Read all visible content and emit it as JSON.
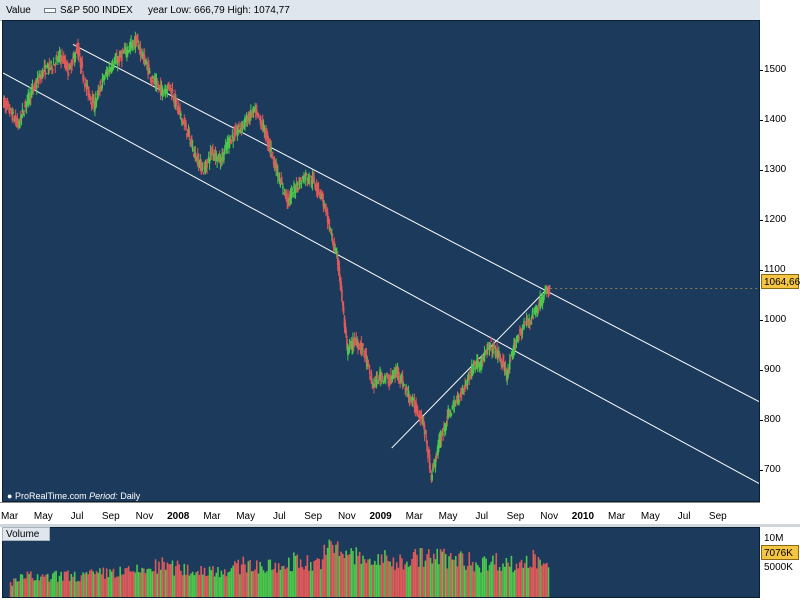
{
  "header": {
    "value_label": "Value",
    "index_name": "S&P 500 INDEX",
    "range_text": "year Low: 666,79  High: 1074,77"
  },
  "credit": {
    "source": "ProRealTime.com",
    "period_label": "Period:",
    "period_value": "Daily"
  },
  "volume_panel": {
    "title": "Volume",
    "last_value_label": "7076K",
    "ticks": [
      {
        "value": 10,
        "label": "10M"
      },
      {
        "value": 5,
        "label": "5000K"
      }
    ],
    "ylim": [
      0,
      12
    ],
    "months": [
      {
        "x": 0,
        "vol": 3.0
      },
      {
        "x": 1,
        "vol": 4.0
      },
      {
        "x": 2,
        "vol": 3.6
      },
      {
        "x": 3,
        "vol": 4.2
      },
      {
        "x": 4,
        "vol": 4.0
      },
      {
        "x": 5,
        "vol": 4.3
      },
      {
        "x": 6,
        "vol": 4.8
      },
      {
        "x": 7,
        "vol": 4.7
      },
      {
        "x": 8,
        "vol": 5.2
      },
      {
        "x": 9,
        "vol": 6.0
      },
      {
        "x": 10,
        "vol": 5.4
      },
      {
        "x": 11,
        "vol": 5.0
      },
      {
        "x": 12,
        "vol": 5.3
      },
      {
        "x": 13,
        "vol": 5.0
      },
      {
        "x": 14,
        "vol": 6.3
      },
      {
        "x": 15,
        "vol": 5.6
      },
      {
        "x": 16,
        "vol": 5.7
      },
      {
        "x": 17,
        "vol": 7.0
      },
      {
        "x": 18,
        "vol": 6.0
      },
      {
        "x": 19,
        "vol": 9.0
      },
      {
        "x": 20,
        "vol": 8.2
      },
      {
        "x": 21,
        "vol": 6.8
      },
      {
        "x": 22,
        "vol": 7.0
      },
      {
        "x": 23,
        "vol": 6.5
      },
      {
        "x": 24,
        "vol": 7.4
      },
      {
        "x": 25,
        "vol": 7.5
      },
      {
        "x": 26,
        "vol": 7.2
      },
      {
        "x": 27,
        "vol": 6.8
      },
      {
        "x": 28,
        "vol": 6.3
      },
      {
        "x": 29,
        "vol": 6.8
      },
      {
        "x": 30,
        "vol": 6.0
      },
      {
        "x": 31,
        "vol": 7.1
      }
    ]
  },
  "colors": {
    "background": "#1b3a5c",
    "up": "#4cc94c",
    "down": "#e05a5a",
    "channel": "#ffffff",
    "tag": "#f4c542"
  },
  "chart_data": {
    "type": "line",
    "title": "S&P 500 INDEX",
    "ylim": [
      635,
      1600
    ],
    "yticks": [
      700,
      800,
      900,
      1000,
      1100,
      1200,
      1300,
      1400,
      1500
    ],
    "last_value_label": "1064,66",
    "x_labels": [
      {
        "x": 0,
        "label": "Mar",
        "year": false
      },
      {
        "x": 2,
        "label": "May",
        "year": false
      },
      {
        "x": 4,
        "label": "Jul",
        "year": false
      },
      {
        "x": 6,
        "label": "Sep",
        "year": false
      },
      {
        "x": 8,
        "label": "Nov",
        "year": false
      },
      {
        "x": 10,
        "label": "2008",
        "year": true
      },
      {
        "x": 12,
        "label": "Mar",
        "year": false
      },
      {
        "x": 14,
        "label": "May",
        "year": false
      },
      {
        "x": 16,
        "label": "Jul",
        "year": false
      },
      {
        "x": 18,
        "label": "Sep",
        "year": false
      },
      {
        "x": 20,
        "label": "Nov",
        "year": false
      },
      {
        "x": 22,
        "label": "2009",
        "year": true
      },
      {
        "x": 24,
        "label": "Mar",
        "year": false
      },
      {
        "x": 26,
        "label": "May",
        "year": false
      },
      {
        "x": 28,
        "label": "Jul",
        "year": false
      },
      {
        "x": 30,
        "label": "Sep",
        "year": false
      },
      {
        "x": 32,
        "label": "Nov",
        "year": false
      },
      {
        "x": 34,
        "label": "2010",
        "year": true
      },
      {
        "x": 36,
        "label": "Mar",
        "year": false
      },
      {
        "x": 38,
        "label": "May",
        "year": false
      },
      {
        "x": 40,
        "label": "Jul",
        "year": false
      },
      {
        "x": 42,
        "label": "Sep",
        "year": false
      }
    ],
    "xlim": [
      -0.45,
      44.5
    ],
    "series": [
      {
        "points": [
          {
            "x": -0.45,
            "y": 1440
          },
          {
            "x": 0,
            "y": 1420
          },
          {
            "x": 0.5,
            "y": 1390
          },
          {
            "x": 1,
            "y": 1440
          },
          {
            "x": 1.5,
            "y": 1470
          },
          {
            "x": 2,
            "y": 1500
          },
          {
            "x": 2.5,
            "y": 1510
          },
          {
            "x": 3,
            "y": 1530
          },
          {
            "x": 3.5,
            "y": 1500
          },
          {
            "x": 4,
            "y": 1545
          },
          {
            "x": 4.5,
            "y": 1470
          },
          {
            "x": 5,
            "y": 1430
          },
          {
            "x": 5.5,
            "y": 1480
          },
          {
            "x": 6,
            "y": 1510
          },
          {
            "x": 6.5,
            "y": 1525
          },
          {
            "x": 7,
            "y": 1545
          },
          {
            "x": 7.5,
            "y": 1560
          },
          {
            "x": 8,
            "y": 1520
          },
          {
            "x": 8.5,
            "y": 1480
          },
          {
            "x": 9,
            "y": 1460
          },
          {
            "x": 9.5,
            "y": 1470
          },
          {
            "x": 10,
            "y": 1420
          },
          {
            "x": 10.5,
            "y": 1380
          },
          {
            "x": 11,
            "y": 1330
          },
          {
            "x": 11.5,
            "y": 1300
          },
          {
            "x": 12,
            "y": 1340
          },
          {
            "x": 12.5,
            "y": 1320
          },
          {
            "x": 13,
            "y": 1360
          },
          {
            "x": 13.5,
            "y": 1380
          },
          {
            "x": 14,
            "y": 1400
          },
          {
            "x": 14.5,
            "y": 1420
          },
          {
            "x": 15,
            "y": 1390
          },
          {
            "x": 15.5,
            "y": 1340
          },
          {
            "x": 16,
            "y": 1280
          },
          {
            "x": 16.5,
            "y": 1240
          },
          {
            "x": 17,
            "y": 1270
          },
          {
            "x": 17.5,
            "y": 1290
          },
          {
            "x": 18,
            "y": 1280
          },
          {
            "x": 18.5,
            "y": 1250
          },
          {
            "x": 19,
            "y": 1180
          },
          {
            "x": 19.5,
            "y": 1110
          },
          {
            "x": 20,
            "y": 940
          },
          {
            "x": 20.5,
            "y": 960
          },
          {
            "x": 21,
            "y": 940
          },
          {
            "x": 21.5,
            "y": 870
          },
          {
            "x": 22,
            "y": 890
          },
          {
            "x": 22.5,
            "y": 880
          },
          {
            "x": 23,
            "y": 900
          },
          {
            "x": 23.5,
            "y": 860
          },
          {
            "x": 24,
            "y": 830
          },
          {
            "x": 24.5,
            "y": 800
          },
          {
            "x": 25,
            "y": 690
          },
          {
            "x": 25.5,
            "y": 760
          },
          {
            "x": 26,
            "y": 810
          },
          {
            "x": 26.5,
            "y": 840
          },
          {
            "x": 27,
            "y": 870
          },
          {
            "x": 27.5,
            "y": 910
          },
          {
            "x": 28,
            "y": 920
          },
          {
            "x": 28.5,
            "y": 950
          },
          {
            "x": 29,
            "y": 930
          },
          {
            "x": 29.5,
            "y": 890
          },
          {
            "x": 30,
            "y": 960
          },
          {
            "x": 30.5,
            "y": 990
          },
          {
            "x": 31,
            "y": 1010
          },
          {
            "x": 31.5,
            "y": 1040
          },
          {
            "x": 32,
            "y": 1064.66
          }
        ]
      }
    ],
    "trendlines": [
      {
        "points": [
          {
            "x": 3.7,
            "y": 1553
          },
          {
            "x": 44.5,
            "y": 836
          }
        ]
      },
      {
        "points": [
          {
            "x": -0.45,
            "y": 1496
          },
          {
            "x": 44.5,
            "y": 672
          }
        ]
      },
      {
        "points": [
          {
            "x": 22.6,
            "y": 745
          },
          {
            "x": 32,
            "y": 1070
          }
        ]
      }
    ]
  }
}
